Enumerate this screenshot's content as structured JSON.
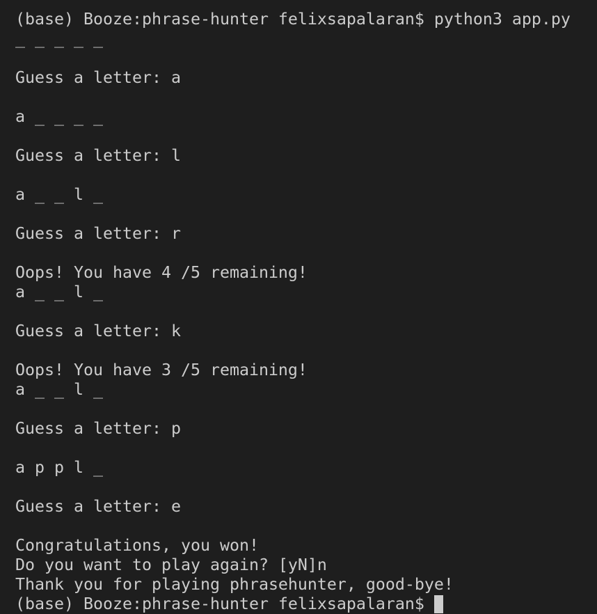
{
  "terminal": {
    "background": "#1e1e1e",
    "foreground": "#cccccc",
    "lines": [
      "(base) Booze:phrase-hunter felixsapalaran$ python3 app.py",
      "_ _ _ _ _",
      "",
      "Guess a letter: a",
      "",
      "a _ _ _ _",
      "",
      "Guess a letter: l",
      "",
      "a _ _ l _",
      "",
      "Guess a letter: r",
      "",
      "Oops! You have 4 /5 remaining!",
      "a _ _ l _",
      "",
      "Guess a letter: k",
      "",
      "Oops! You have 3 /5 remaining!",
      "a _ _ l _",
      "",
      "Guess a letter: p",
      "",
      "a p p l _",
      "",
      "Guess a letter: e",
      "",
      "Congratulations, you won!",
      "Do you want to play again? [yN]n",
      "Thank you for playing phrasehunter, good-bye!"
    ],
    "prompt": "(base) Booze:phrase-hunter felixsapalaran$ "
  }
}
